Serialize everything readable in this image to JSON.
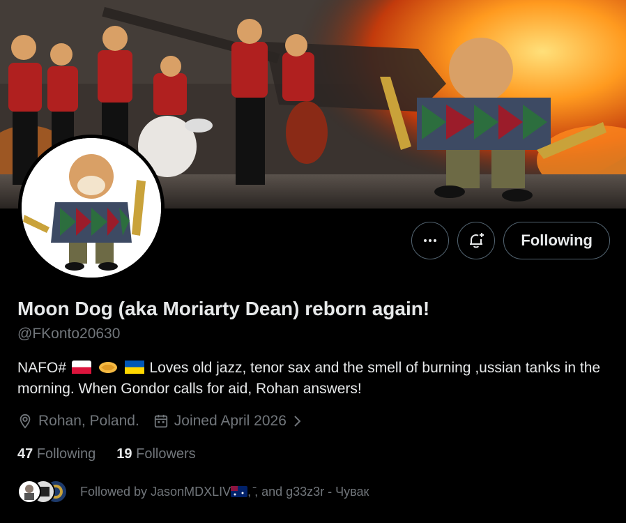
{
  "profile": {
    "display_name": "Moon Dog (aka Moriarty Dean) reborn again!",
    "handle": "@FKonto20630",
    "bio_prefix": "NAFO#",
    "bio_text": "Loves old jazz, tenor sax and the smell of burning ,ussian tanks in the morning. When Gondor calls for aid, Rohan answers!",
    "location": "Rohan, Poland.",
    "joined": "Joined April 2026"
  },
  "actions": {
    "more_icon": "more-dots-icon",
    "notify_icon": "bell-plus-icon",
    "following_label": "Following"
  },
  "stats": {
    "following_count": "47",
    "following_label": "Following",
    "followers_count": "19",
    "followers_label": "Followers"
  },
  "followed_by": {
    "text": "Followed by JasonMDXLIV",
    "text_suffix": ", ̄, and g33z3r - Чувак"
  },
  "colors": {
    "background": "#000000",
    "primary_text": "#e7e9ea",
    "secondary_text": "#71767b",
    "border": "#536471"
  }
}
